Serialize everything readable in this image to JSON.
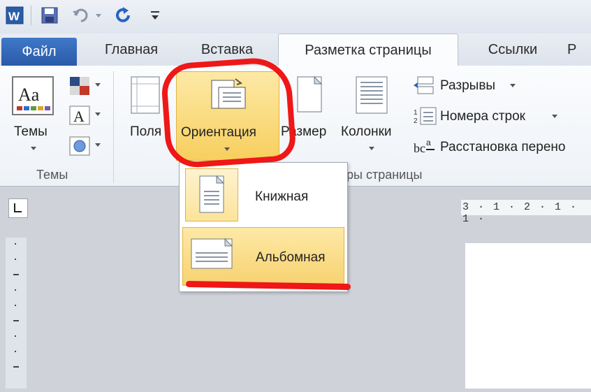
{
  "qat": {
    "icons": [
      "word-icon",
      "save-icon",
      "undo-icon",
      "redo-icon",
      "customize-icon"
    ]
  },
  "tabs": {
    "file": "Файл",
    "home": "Главная",
    "insert": "Вставка",
    "layout": "Разметка страницы",
    "refs": "Ссылки",
    "cut": "Р"
  },
  "ribbon": {
    "themes_btn": "Темы",
    "themes_group": "Темы",
    "margins": "Поля",
    "orientation": "Ориентация",
    "size": "Размер",
    "columns": "Колонки",
    "page_setup_group": "ры страницы",
    "breaks": "Разрывы",
    "line_numbers": "Номера строк",
    "hyphenation": "Расстановка перено"
  },
  "orientation_menu": {
    "portrait": "Книжная",
    "landscape": "Альбомная"
  },
  "ruler": {
    "marks": "3 · 1 · 2 · 1 · 1 ·"
  },
  "colors": {
    "file_tab": "#2a5aa7",
    "highlight": "#f7cf5e",
    "annotation": "#ef1717"
  }
}
